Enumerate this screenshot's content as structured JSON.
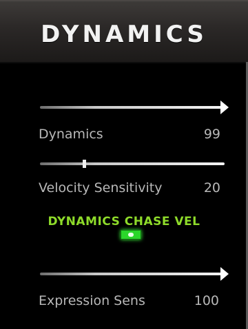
{
  "panel": {
    "title": "DYNAMICS"
  },
  "controls": {
    "dynamics": {
      "label": "Dynamics",
      "value": "99",
      "position": 1.0
    },
    "velocity_sensitivity": {
      "label": "Velocity Sensitivity",
      "value": "20",
      "position": 0.24
    },
    "dynamics_chase_vel": {
      "label": "DYNAMICS CHASE VEL",
      "state": "on"
    },
    "expression_sens": {
      "label": "Expression Sens",
      "value": "100",
      "position": 1.0
    }
  },
  "colors": {
    "label_text": "#b8b8b8",
    "accent_green": "#8edb2a",
    "led_on": "#2bd62b"
  }
}
